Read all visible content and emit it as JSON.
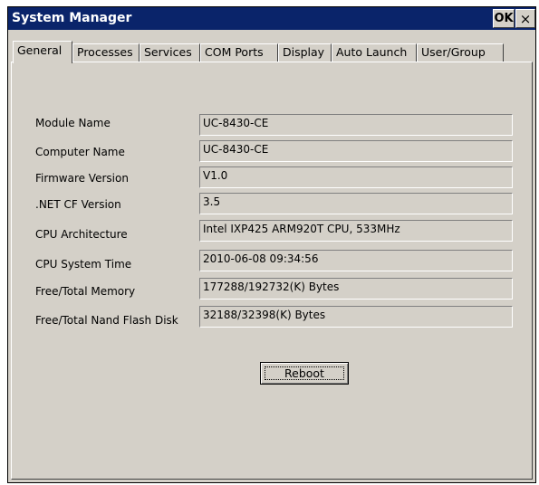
{
  "window": {
    "title": "System Manager",
    "ok_label": "OK",
    "close_label": "×"
  },
  "tabs": [
    {
      "label": "General",
      "active": true
    },
    {
      "label": "Processes",
      "active": false
    },
    {
      "label": "Services",
      "active": false
    },
    {
      "label": "COM Ports",
      "active": false
    },
    {
      "label": "Display",
      "active": false
    },
    {
      "label": "Auto Launch",
      "active": false
    },
    {
      "label": "User/Group",
      "active": false
    }
  ],
  "info": [
    {
      "label": "Module Name",
      "value": "UC-8430-CE"
    },
    {
      "label": "Computer Name",
      "value": "UC-8430-CE"
    },
    {
      "label": "Firmware Version",
      "value": "V1.0"
    },
    {
      "label": ".NET CF Version",
      "value": "3.5"
    },
    {
      "label": "CPU Architecture",
      "value": "Intel IXP425 ARM920T CPU, 533MHz"
    },
    {
      "label": "CPU System Time",
      "value": "2010-06-08 09:34:56"
    },
    {
      "label": "Free/Total Memory",
      "value": "177288/192732(K) Bytes"
    },
    {
      "label": "Free/Total Nand Flash Disk",
      "value": "32188/32398(K) Bytes"
    }
  ],
  "reboot_label": "Reboot",
  "colors": {
    "titlebar": "#0a246a",
    "face": "#d4d0c8"
  }
}
